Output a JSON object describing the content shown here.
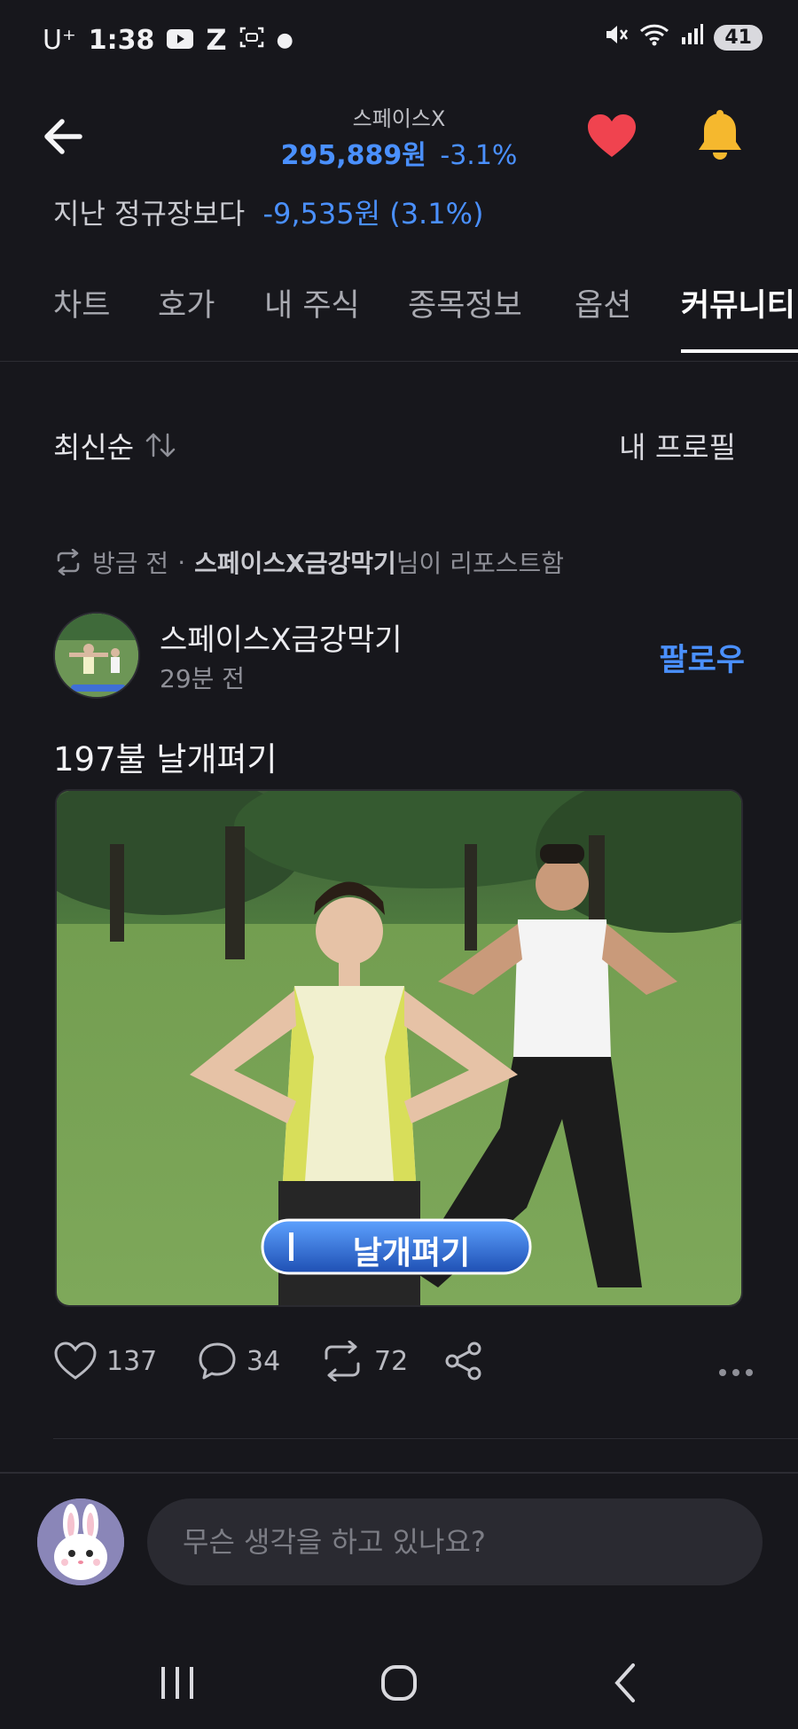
{
  "status_bar": {
    "carrier": "U⁺",
    "time": "1:38",
    "battery": "41"
  },
  "header": {
    "stock_name": "스페이스X",
    "price": "295,889원",
    "change": "-3.1%",
    "compare_label": "지난 정규장보다",
    "compare_value": "-9,535원 (3.1%)"
  },
  "tabs": [
    {
      "label": "차트"
    },
    {
      "label": "호가"
    },
    {
      "label": "내 주식"
    },
    {
      "label": "종목정보"
    },
    {
      "label": "옵션"
    },
    {
      "label": "커뮤니티",
      "active": true
    }
  ],
  "feed": {
    "sort_label": "최신순",
    "profile_label": "내 프로필"
  },
  "post": {
    "repost_time": "방금 전",
    "repost_user": "스페이스X금강막기",
    "repost_suffix": "님이 리포스트함",
    "author": "스페이스X금강막기",
    "time": "29분 전",
    "follow_label": "팔로우",
    "text": "197불 날개펴기",
    "image_caption": "날개펴기",
    "likes": "137",
    "comments": "34",
    "reposts": "72"
  },
  "composer": {
    "placeholder": "무슨 생각을 하고 있나요?"
  },
  "colors": {
    "background": "#17171c",
    "accent_blue": "#4a90ff",
    "heart_red": "#f0434f",
    "bell_yellow": "#f5b82e"
  }
}
